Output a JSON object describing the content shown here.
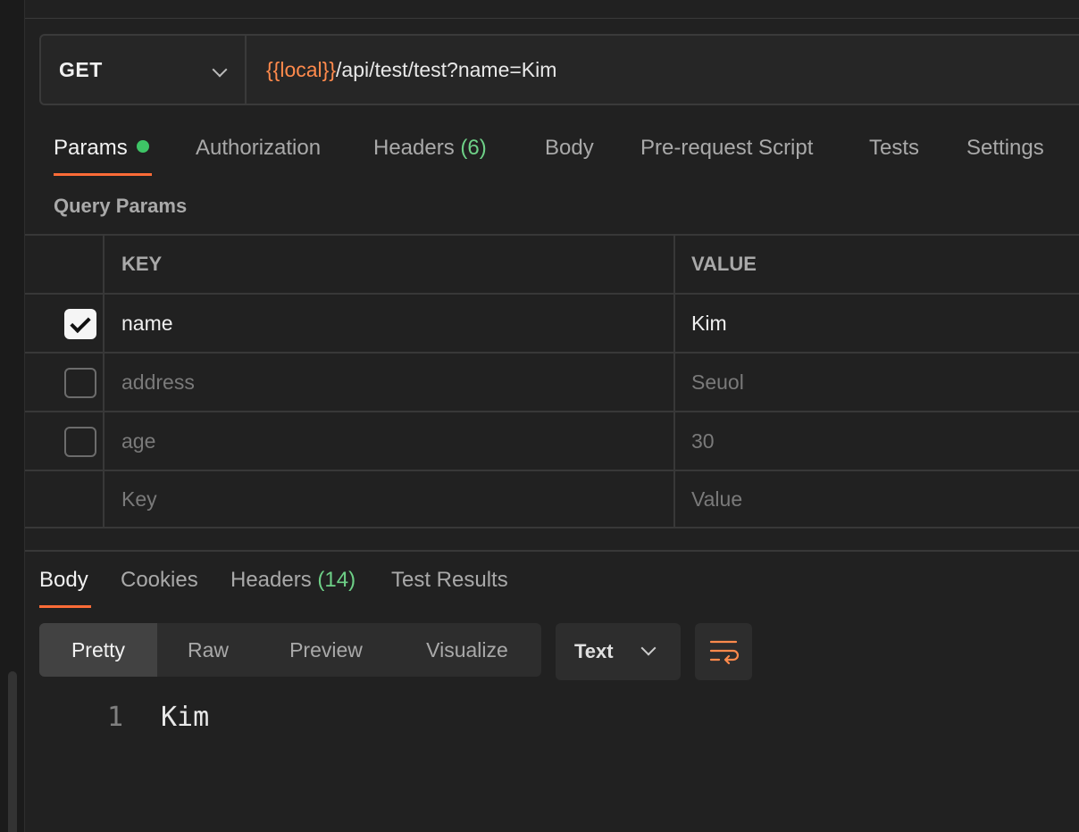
{
  "request": {
    "method": "GET",
    "url_variable": "{{local}}",
    "url_path": "/api/test/test?name=Kim"
  },
  "request_tabs": [
    {
      "label": "Params",
      "active": true
    },
    {
      "label": "Authorization"
    },
    {
      "label": "Headers",
      "count": "(6)"
    },
    {
      "label": "Body"
    },
    {
      "label": "Pre-request Script"
    },
    {
      "label": "Tests"
    },
    {
      "label": "Settings"
    }
  ],
  "params": {
    "title": "Query Params",
    "columns": {
      "key": "KEY",
      "value": "VALUE"
    },
    "rows": [
      {
        "key": "name",
        "value": "Kim",
        "checked": true
      },
      {
        "key": "address",
        "value": "Seuol",
        "checked": false
      },
      {
        "key": "age",
        "value": "30",
        "checked": false
      }
    ],
    "placeholder": {
      "key": "Key",
      "value": "Value"
    }
  },
  "response_tabs": [
    {
      "label": "Body",
      "active": true
    },
    {
      "label": "Cookies"
    },
    {
      "label": "Headers",
      "count": "(14)"
    },
    {
      "label": "Test Results"
    }
  ],
  "view_modes": [
    "Pretty",
    "Raw",
    "Preview",
    "Visualize"
  ],
  "active_view_mode": "Pretty",
  "format": "Text",
  "icons": {
    "wrap": "wrap-lines-icon",
    "chevron": "chevron-down-icon",
    "check": "check-icon"
  },
  "response_body": {
    "line_number": "1",
    "text": "Kim"
  },
  "colors": {
    "accent": "#ff6c37",
    "variable": "#ff8a4c",
    "count": "#6ed087",
    "status_dot": "#3ec466"
  }
}
